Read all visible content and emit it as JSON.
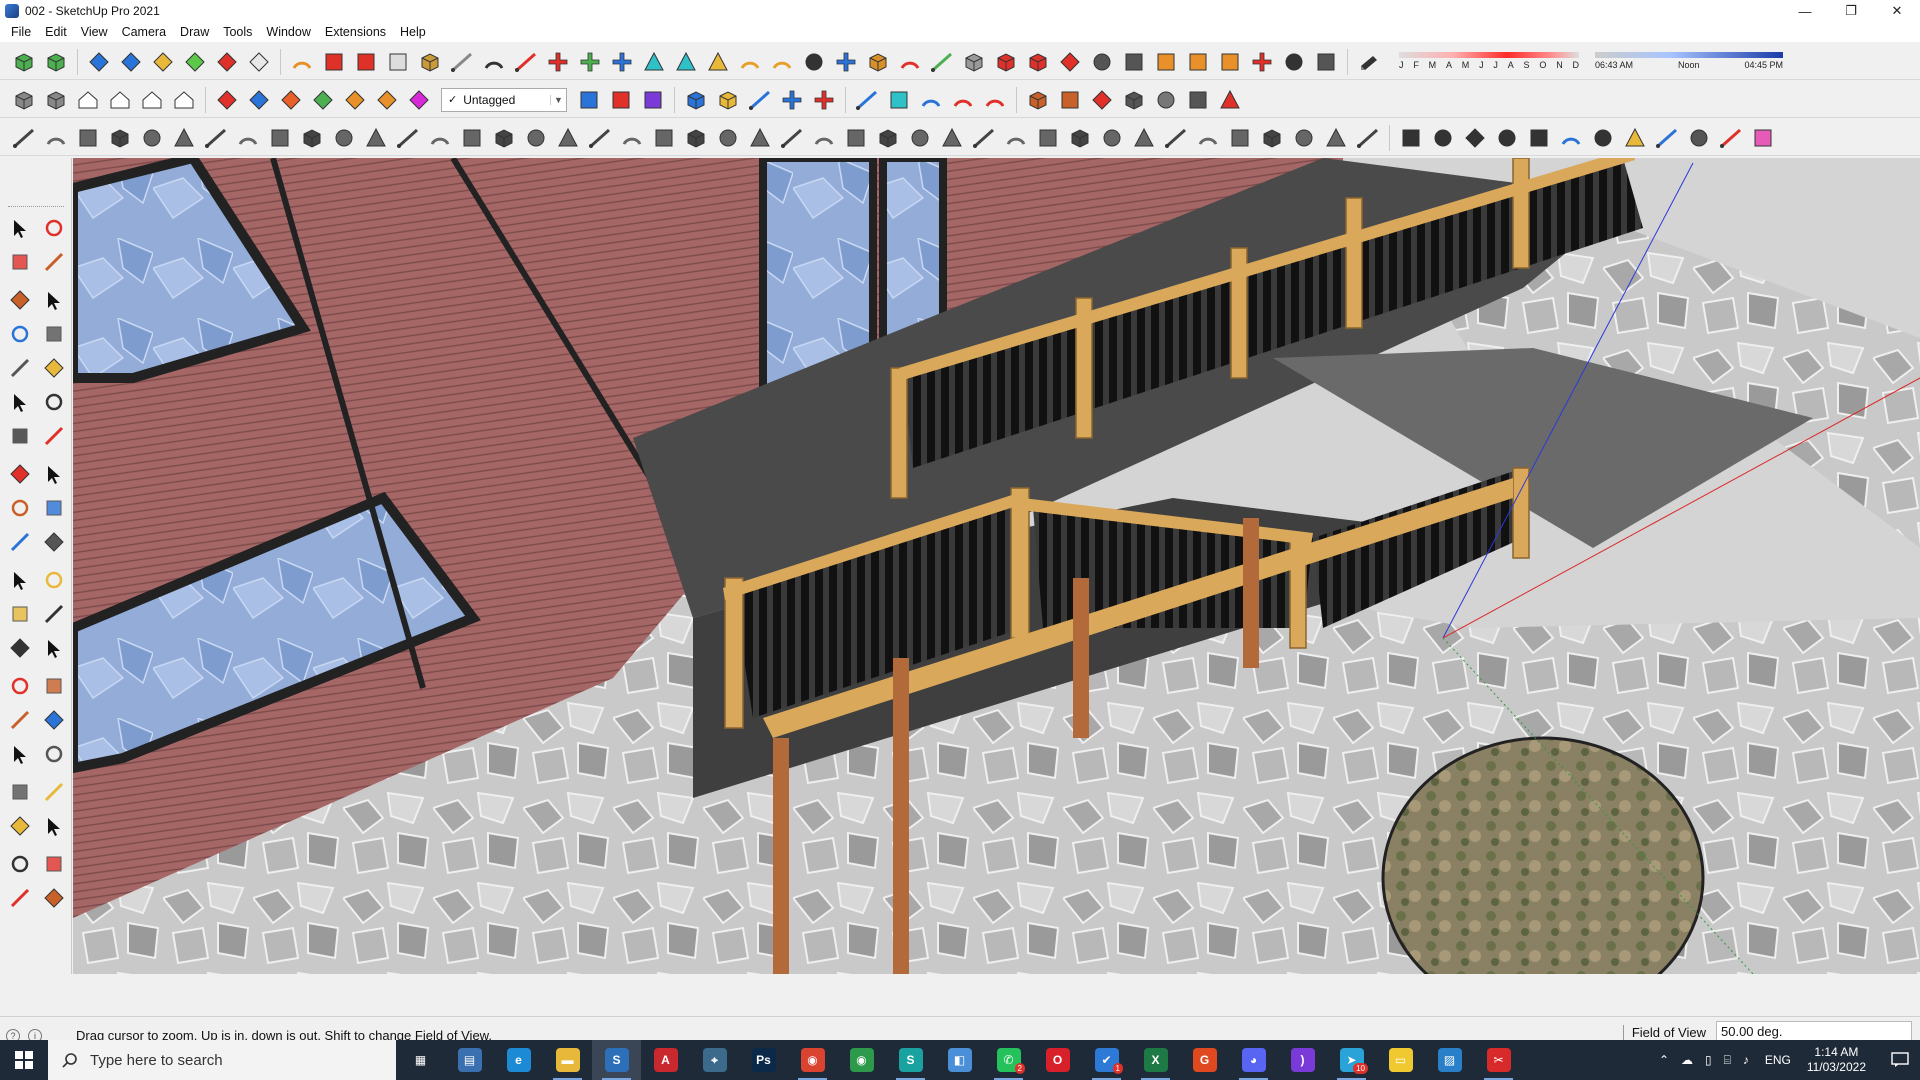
{
  "window": {
    "title": "002 - SketchUp Pro 2021",
    "minimize": "—",
    "restore": "❐",
    "close": "✕"
  },
  "menu": [
    "File",
    "Edit",
    "View",
    "Camera",
    "Draw",
    "Tools",
    "Window",
    "Extensions",
    "Help"
  ],
  "toolbar": {
    "tag_selector": {
      "check": "✓",
      "value": "Untagged",
      "arrow": "▼"
    },
    "shadows": {
      "months": [
        "J",
        "F",
        "M",
        "A",
        "M",
        "J",
        "J",
        "A",
        "S",
        "O",
        "N",
        "D"
      ],
      "time_start": "06:43 AM",
      "time_mid": "Noon",
      "time_end": "04:45 PM"
    }
  },
  "status": {
    "message": "Drag cursor to zoom.  Up is in, down is out. Shift to change Field of View.",
    "measurement_label": "Field of View",
    "measurement_value": "50.00 deg."
  },
  "taskbar": {
    "search_placeholder": "Type here to search",
    "language": "ENG",
    "time": "1:14 AM",
    "date": "11/03/2022",
    "badges": {
      "whatsapp": "2",
      "todo": "1",
      "telegram": "10"
    },
    "apps": [
      {
        "name": "task-view",
        "color": "#1f2a38",
        "glyph": "▦"
      },
      {
        "name": "calculator",
        "color": "#3a6fb0",
        "glyph": "▤"
      },
      {
        "name": "edge",
        "color": "#1d8ad6",
        "glyph": "e"
      },
      {
        "name": "file-explorer",
        "color": "#e8b83a",
        "glyph": "▬"
      },
      {
        "name": "sketchup",
        "color": "#2d6fb8",
        "glyph": "S"
      },
      {
        "name": "autocad",
        "color": "#c8282e",
        "glyph": "A"
      },
      {
        "name": "network-tool",
        "color": "#3c6a8a",
        "glyph": "⌖"
      },
      {
        "name": "photoshop",
        "color": "#0b2a4a",
        "glyph": "Ps"
      },
      {
        "name": "chrome",
        "color": "#d9432f",
        "glyph": "◉"
      },
      {
        "name": "chrome-2",
        "color": "#2c9a4a",
        "glyph": "◉"
      },
      {
        "name": "sketchup-viewer",
        "color": "#1aa2a0",
        "glyph": "S"
      },
      {
        "name": "layout",
        "color": "#4a8fd8",
        "glyph": "◧"
      },
      {
        "name": "whatsapp",
        "color": "#25c15a",
        "glyph": "✆"
      },
      {
        "name": "opera",
        "color": "#d8202a",
        "glyph": "O"
      },
      {
        "name": "todo",
        "color": "#2d7ad6",
        "glyph": "✔"
      },
      {
        "name": "excel",
        "color": "#1d7a44",
        "glyph": "X"
      },
      {
        "name": "graphics-app",
        "color": "#e04820",
        "glyph": "G"
      },
      {
        "name": "discord",
        "color": "#5865f2",
        "glyph": "◕"
      },
      {
        "name": "podcast-app",
        "color": "#7a3ad8",
        "glyph": ")"
      },
      {
        "name": "telegram",
        "color": "#2aa3d8",
        "glyph": "➤"
      },
      {
        "name": "sticky-notes",
        "color": "#f0c830",
        "glyph": "▭"
      },
      {
        "name": "photos",
        "color": "#2a80c8",
        "glyph": "▨"
      },
      {
        "name": "screen-snip",
        "color": "#d82a2a",
        "glyph": "✂"
      }
    ]
  }
}
